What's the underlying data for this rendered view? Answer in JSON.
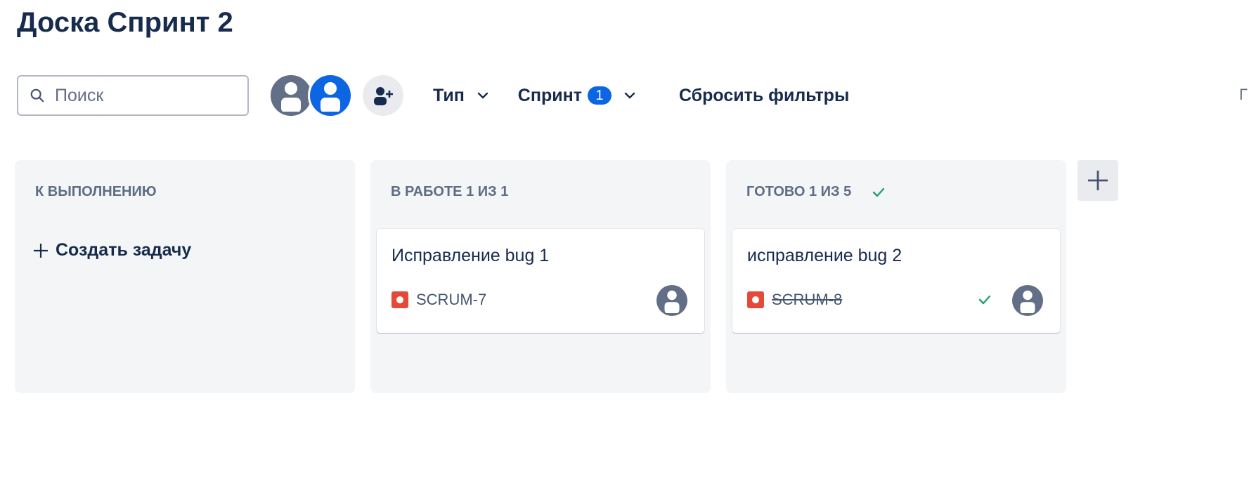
{
  "board": {
    "title": "Доска Спринт 2"
  },
  "toolbar": {
    "search_placeholder": "Поиск",
    "type_filter_label": "Тип",
    "sprint_filter_label": "Спринт",
    "sprint_filter_count": "1",
    "reset_filters_label": "Сбросить фильтры",
    "edge_text": "Г"
  },
  "icons": {
    "search": "search-icon",
    "avatar": "user-avatar-icon",
    "add_people": "add-people-icon",
    "chevron": "chevron-down-icon",
    "plus": "plus-icon",
    "check": "check-icon",
    "bug": "bug-icon"
  },
  "colors": {
    "text_primary": "#172b4d",
    "column_bg": "#f4f5f7",
    "accent_blue": "#0c66e4",
    "avatar_gray": "#626f86",
    "bug_red": "#e5493a",
    "done_green": "#22a06b"
  },
  "columns": [
    {
      "title": "К ВЫПОЛНЕНИЮ",
      "create_label": "Создать задачу"
    },
    {
      "title": "В РАБОТЕ 1 ИЗ 1",
      "cards": [
        {
          "summary": "Исправление bug 1",
          "key": "SCRUM-7",
          "done": false
        }
      ]
    },
    {
      "title": "ГОТОВО 1 ИЗ 5",
      "cards": [
        {
          "summary": "исправление bug 2",
          "key": "SCRUM-8",
          "done": true
        }
      ]
    }
  ]
}
